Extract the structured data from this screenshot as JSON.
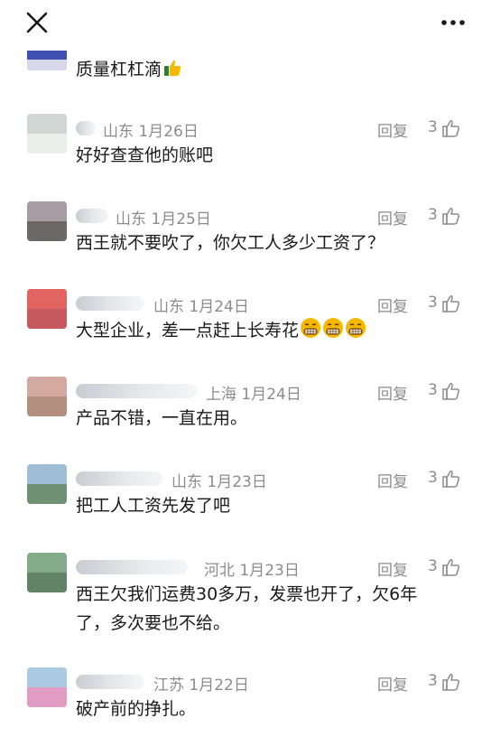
{
  "header": {
    "close_icon": "close-icon",
    "more_icon": "more-dots-icon"
  },
  "colors": {
    "meta_text": "#8c8c8c",
    "body_text": "#1a1a1a",
    "emoji_yellow": "#f5b800"
  },
  "comments": [
    {
      "location": "",
      "date": "",
      "reply": "",
      "likes": "",
      "text": "质量杠杠滴",
      "emoji": "thumbs-up"
    },
    {
      "location": "山东",
      "date": "1月26日",
      "reply": "回复",
      "likes": "3",
      "text": "好好查查他的账吧"
    },
    {
      "location": "山东",
      "date": "1月25日",
      "reply": "回复",
      "likes": "3",
      "text": "西王就不要吹了，你欠工人多少工资了？"
    },
    {
      "location": "山东",
      "date": "1月24日",
      "reply": "回复",
      "likes": "3",
      "text": "大型企业，差一点赶上长寿花",
      "emoji": "grin x3"
    },
    {
      "location": "上海",
      "date": "1月24日",
      "reply": "回复",
      "likes": "3",
      "text": "产品不错，一直在用。"
    },
    {
      "location": "山东",
      "date": "1月23日",
      "reply": "回复",
      "likes": "3",
      "text": "把工人工资先发了吧"
    },
    {
      "location": "河北",
      "date": "1月23日",
      "reply": "回复",
      "likes": "3",
      "text_line1": "西王欠我们运费30多万，发票也开了，欠6年",
      "text_line2": "了，多次要也不给。"
    },
    {
      "location": "江苏",
      "date": "1月22日",
      "reply": "回复",
      "likes": "3",
      "text": "破产前的挣扎。"
    }
  ]
}
